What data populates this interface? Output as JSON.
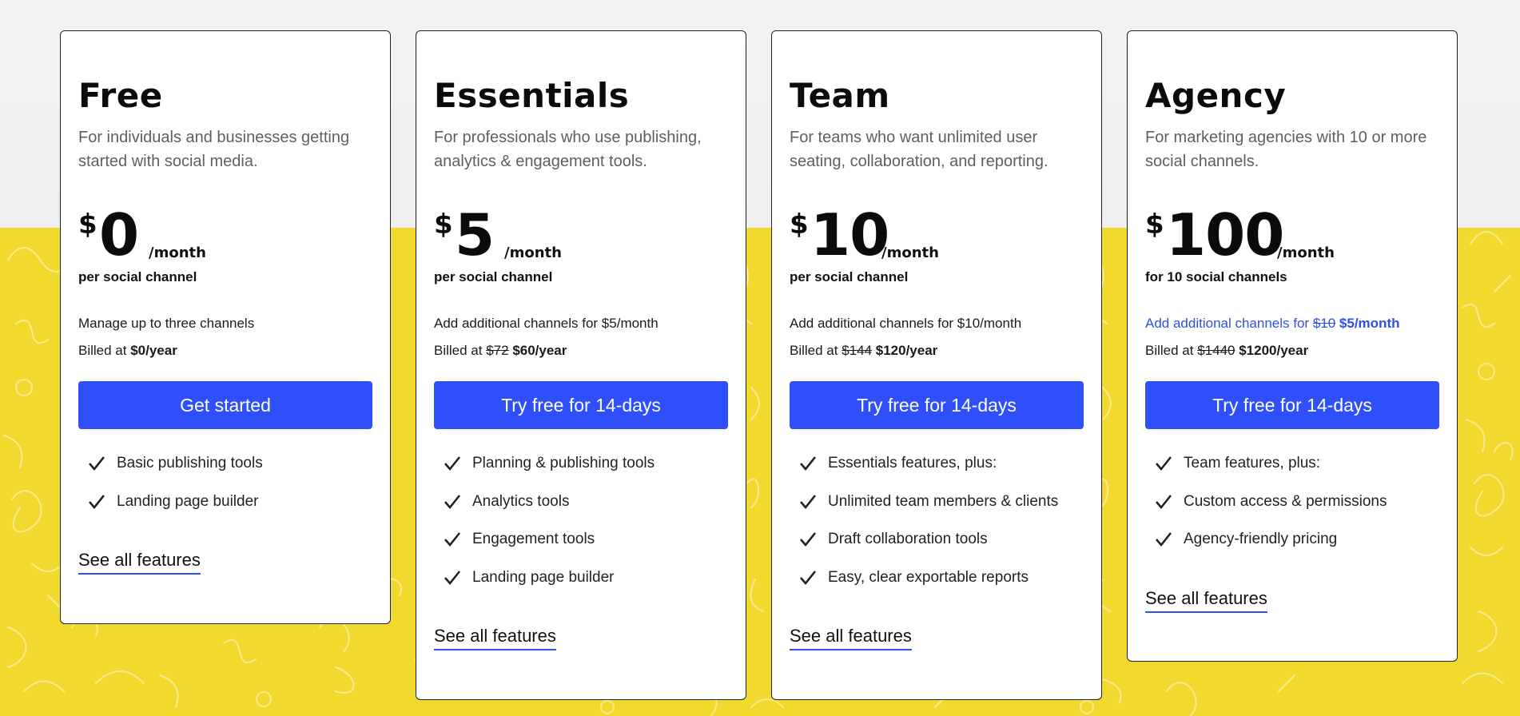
{
  "colors": {
    "accent": "#2e4ffa",
    "background_yellow": "#f2d92e",
    "link_blue": "#2f50e6"
  },
  "plans": [
    {
      "name": "Free",
      "description": "For individuals and businesses getting started with social media.",
      "currency": "$",
      "price": "0",
      "period": "/month",
      "unit": "per social channel",
      "info_line": "Manage up to three channels",
      "billed_prefix": "Billed at ",
      "billed_old": "",
      "billed_new": "$0/year",
      "cta": "Get started",
      "features": [
        "Basic publishing tools",
        "Landing page builder"
      ],
      "see_all": "See all features"
    },
    {
      "name": "Essentials",
      "description": "For professionals who use publishing, analytics & engagement tools.",
      "currency": "$",
      "price": "5",
      "period": "/month",
      "unit": "per social channel",
      "info_line": "Add additional channels for $5/month",
      "billed_prefix": "Billed at ",
      "billed_old": "$72",
      "billed_new": "$60/year",
      "cta": "Try free for 14-days",
      "features": [
        "Planning & publishing tools",
        "Analytics tools",
        "Engagement tools",
        "Landing page builder"
      ],
      "see_all": "See all features"
    },
    {
      "name": "Team",
      "description": "For teams who want unlimited user seating, collaboration, and reporting.",
      "currency": "$",
      "price": "10",
      "period": "/month",
      "unit": "per social channel",
      "info_line": "Add additional channels for $10/month",
      "billed_prefix": "Billed at ",
      "billed_old": "$144",
      "billed_new": "$120/year",
      "cta": "Try free for 14-days",
      "features": [
        "Essentials features, plus:",
        "Unlimited team members & clients",
        "Draft collaboration tools",
        "Easy, clear exportable reports"
      ],
      "see_all": "See all features"
    },
    {
      "name": "Agency",
      "description": "For marketing agencies with 10 or more social channels.",
      "currency": "$",
      "price": "100",
      "period": "/month",
      "unit": "for 10 social channels",
      "info_prefix": "Add additional channels for ",
      "info_old": "$10",
      "info_new": "$5/month",
      "billed_prefix": "Billed at ",
      "billed_old": "$1440",
      "billed_new": "$1200/year",
      "cta": "Try free for 14-days",
      "features": [
        "Team features, plus:",
        "Custom access & permissions",
        "Agency-friendly pricing"
      ],
      "see_all": "See all features"
    }
  ]
}
